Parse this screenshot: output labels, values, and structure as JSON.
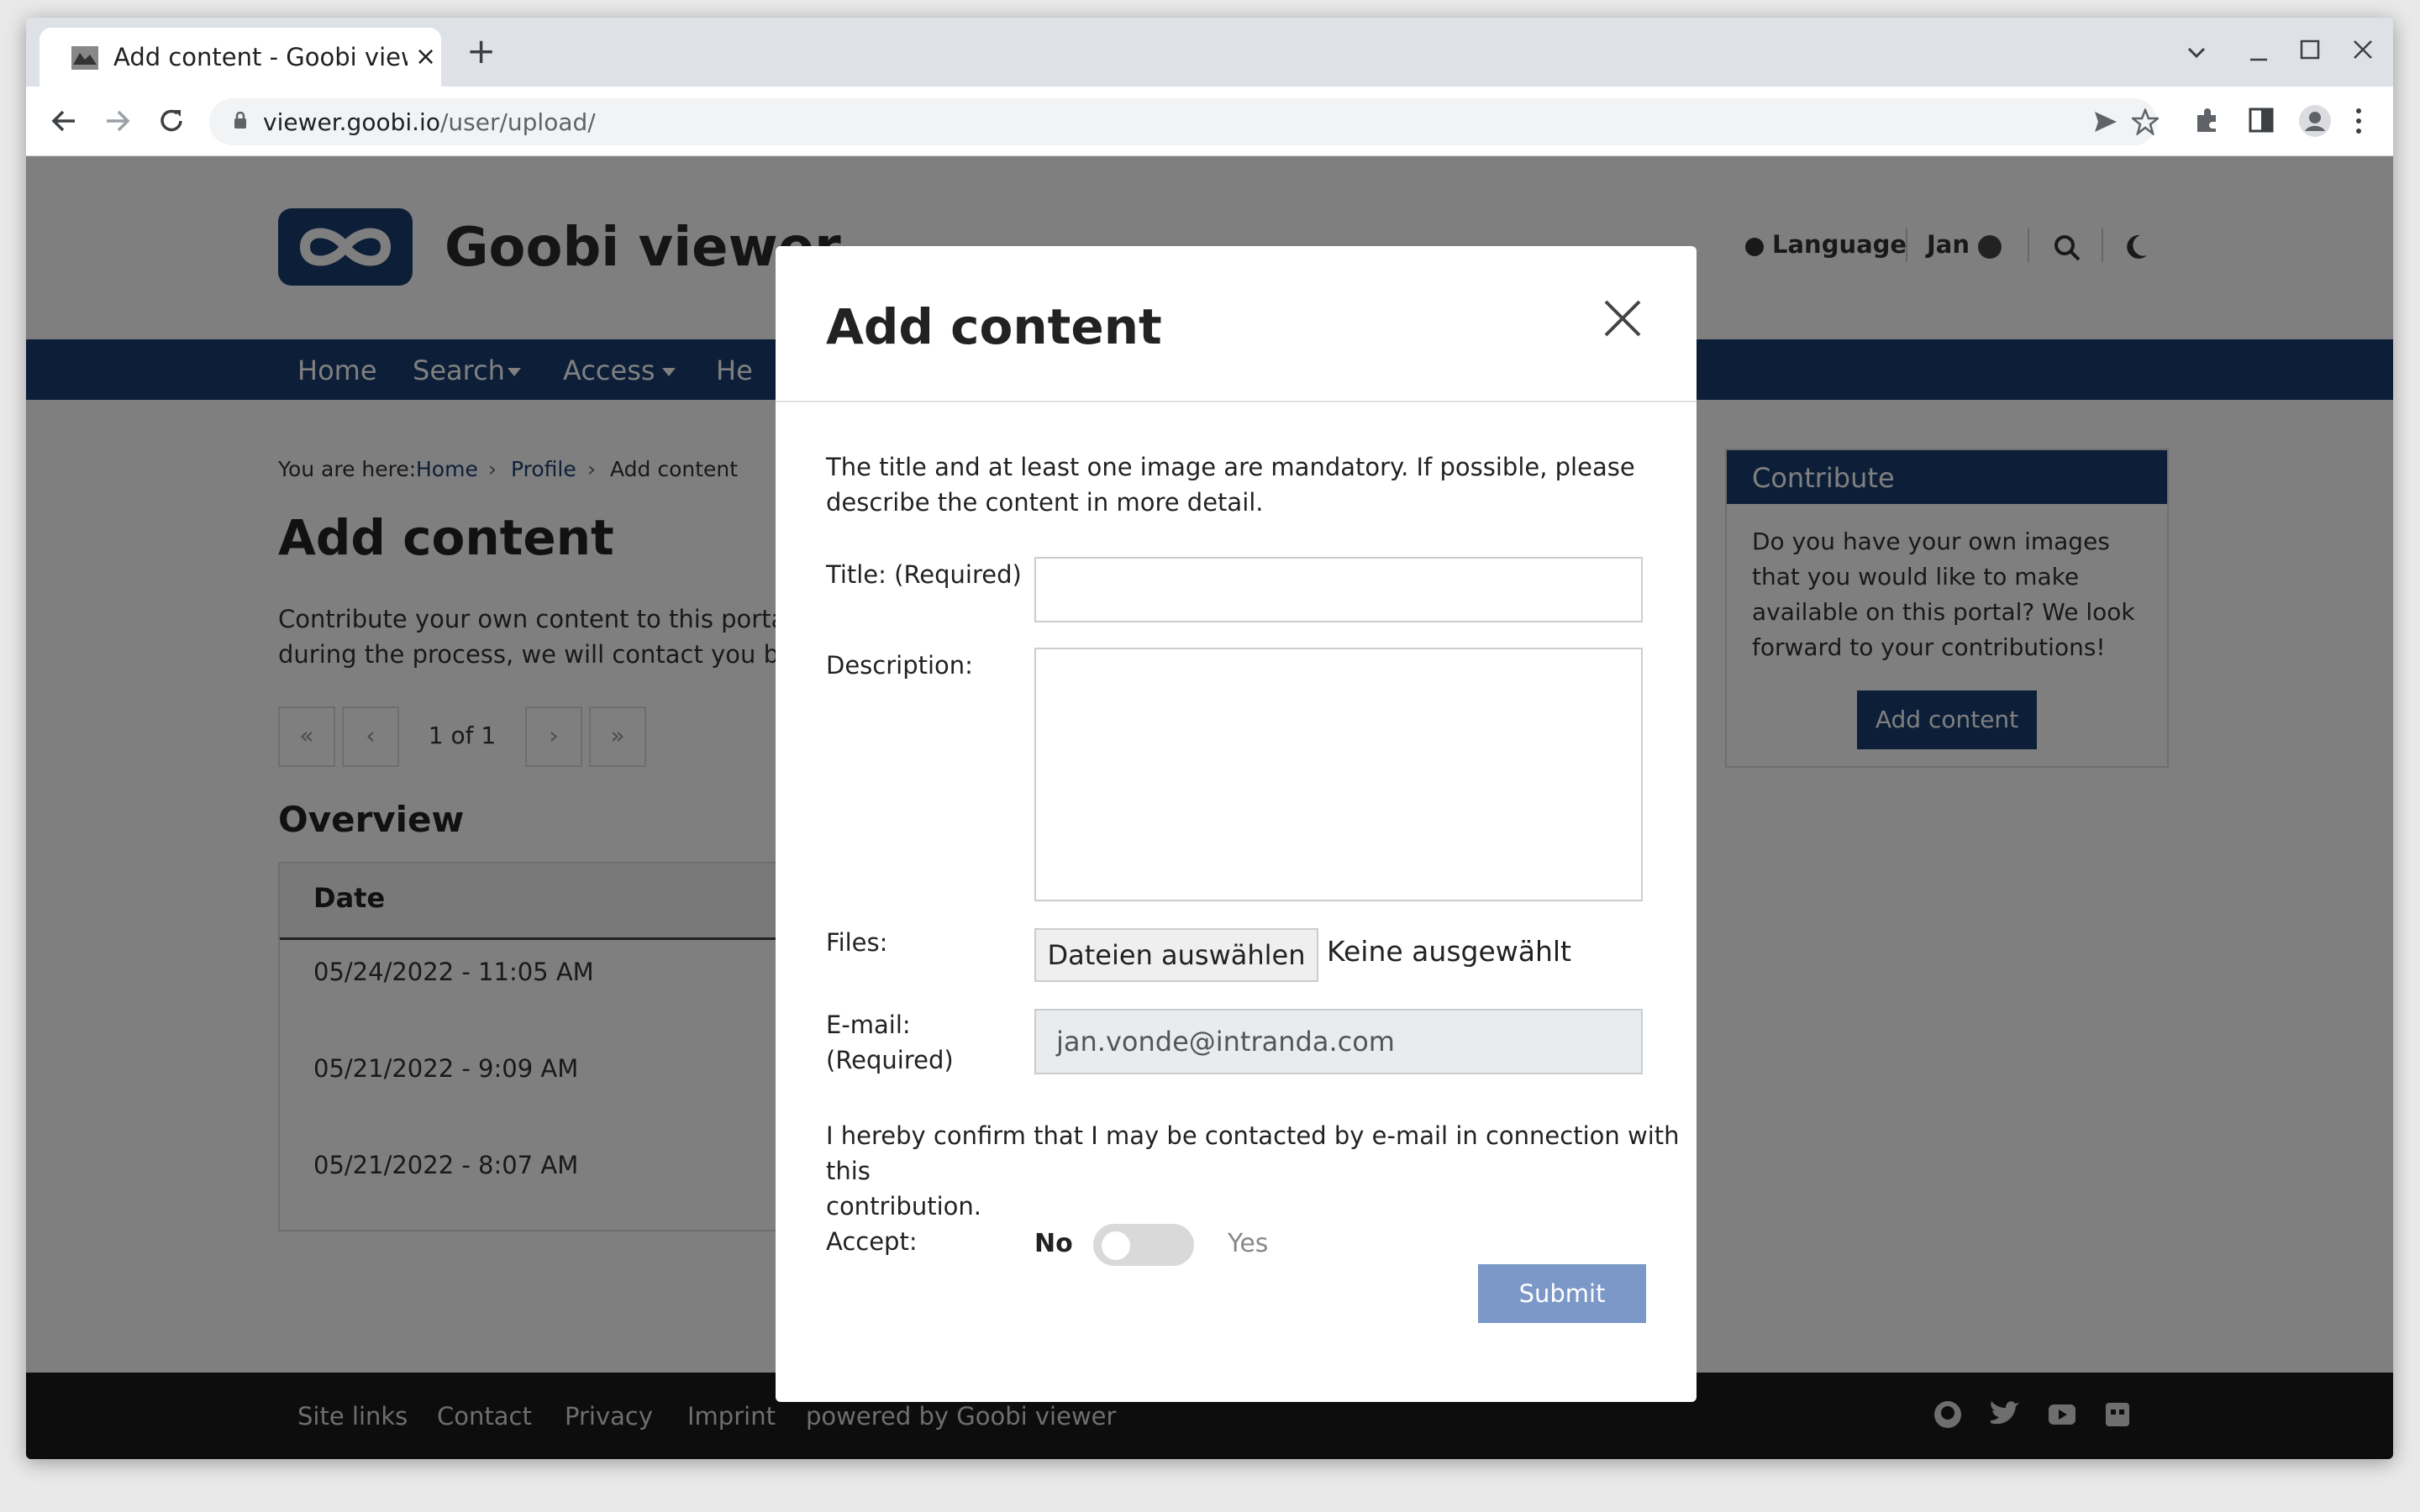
{
  "browser": {
    "tab_title": "Add content - Goobi viewer",
    "tab_close": "×",
    "new_tab": "+",
    "url_host": "viewer.goobi.io",
    "url_path": "/user/upload/"
  },
  "header": {
    "site_name": "Goobi viewer",
    "language": "Language",
    "user": "Jan"
  },
  "nav": {
    "items": [
      "Home",
      "Search",
      "Access",
      "He"
    ]
  },
  "breadcrumb": {
    "prefix": "You are here:",
    "home": "Home",
    "profile": "Profile",
    "current": "Add content",
    "sep": "›"
  },
  "main": {
    "title": "Add content",
    "intro_line1": "Contribute your own content to this portal.",
    "intro_line2": "during the process, we will contact you by",
    "pager": {
      "first": "«",
      "prev": "‹",
      "status": "1 of 1",
      "next": "›",
      "last": "»"
    },
    "overview_title": "Overview",
    "table": {
      "header": "Date",
      "rows": [
        "05/24/2022 - 11:05 AM",
        "05/21/2022 - 9:09 AM",
        "05/21/2022 - 8:07 AM"
      ]
    }
  },
  "sidebar": {
    "title": "Contribute",
    "text": "Do you have your own images that you would like to make available on this portal? We look forward to your contributions!",
    "button": "Add content"
  },
  "footer": {
    "links": [
      "Site links",
      "Contact",
      "Privacy",
      "Imprint",
      "powered by Goobi viewer"
    ],
    "icons": [
      "github-icon",
      "twitter-icon",
      "youtube-icon",
      "gitlab-icon"
    ]
  },
  "modal": {
    "title": "Add content",
    "info_line1": "The title and at least one image are mandatory. If possible, please",
    "info_line2": "describe the content in more detail.",
    "title_label": "Title: (Required)",
    "title_value": "",
    "description_label": "Description:",
    "description_value": "",
    "files_label": "Files:",
    "files_button": "Dateien auswählen",
    "files_status": "Keine ausgewählt",
    "email_label_line1": "E-mail:",
    "email_label_line2": "(Required)",
    "email_value": "jan.vonde@intranda.com",
    "confirm_line1": "I hereby confirm that I may be contacted by e-mail in connection with this",
    "confirm_line2": "contribution.",
    "accept_label": "Accept:",
    "toggle_no": "No",
    "toggle_yes": "Yes",
    "accepted": false,
    "submit": "Submit"
  },
  "colors": {
    "brand": "#1a3f70",
    "submit": "#7b98c8"
  }
}
